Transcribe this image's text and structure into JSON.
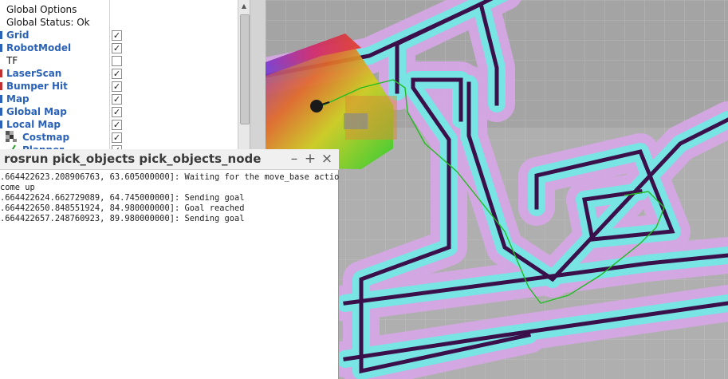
{
  "displays": {
    "rows": [
      {
        "label": "Global Options",
        "style": "plain",
        "checked": null
      },
      {
        "label": "Global Status: Ok",
        "style": "plain",
        "checked": null
      },
      {
        "label": "Grid",
        "style": "display",
        "checked": true
      },
      {
        "label": "RobotModel",
        "style": "display",
        "checked": true
      },
      {
        "label": "TF",
        "style": "plain",
        "checked": false
      },
      {
        "label": "LaserScan",
        "style": "display",
        "checked": true
      },
      {
        "label": "Bumper Hit",
        "style": "display",
        "checked": true
      },
      {
        "label": "Map",
        "style": "display",
        "checked": true
      },
      {
        "label": "Global Map",
        "style": "display",
        "checked": true
      },
      {
        "label": "Local Map",
        "style": "display",
        "checked": true
      },
      {
        "label": "Costmap",
        "style": "display",
        "checked": true,
        "indent": true,
        "icon": "costmap-icon"
      },
      {
        "label": "Planner",
        "style": "display",
        "checked": true,
        "indent": true,
        "icon": "planner-icon"
      }
    ],
    "check_mark": "✓"
  },
  "terminal": {
    "title": "rosrun pick_objects pick_objects_node",
    "minimize_glyph": "–",
    "maximize_glyph": "+",
    "close_glyph": "×",
    "lines": [
      ".664422623.208906763, 63.605000000]: Waiting for the move_base action s",
      "come up",
      ".664422624.662729089, 64.745000000]: Sending goal",
      ".664422650.848551924, 84.980000000]: Goal reached",
      ".664422657.248760923, 89.980000000]: Sending goal"
    ]
  },
  "colors": {
    "map_background": "#a4a4a4",
    "grid_lines": "#b6b6b6",
    "wall": "#3a0f4a",
    "inflation_inner": "#7fe3e3",
    "inflation_outer": "#d6a6e6",
    "path": "#22bb22",
    "display_text": "#2a62b8"
  }
}
